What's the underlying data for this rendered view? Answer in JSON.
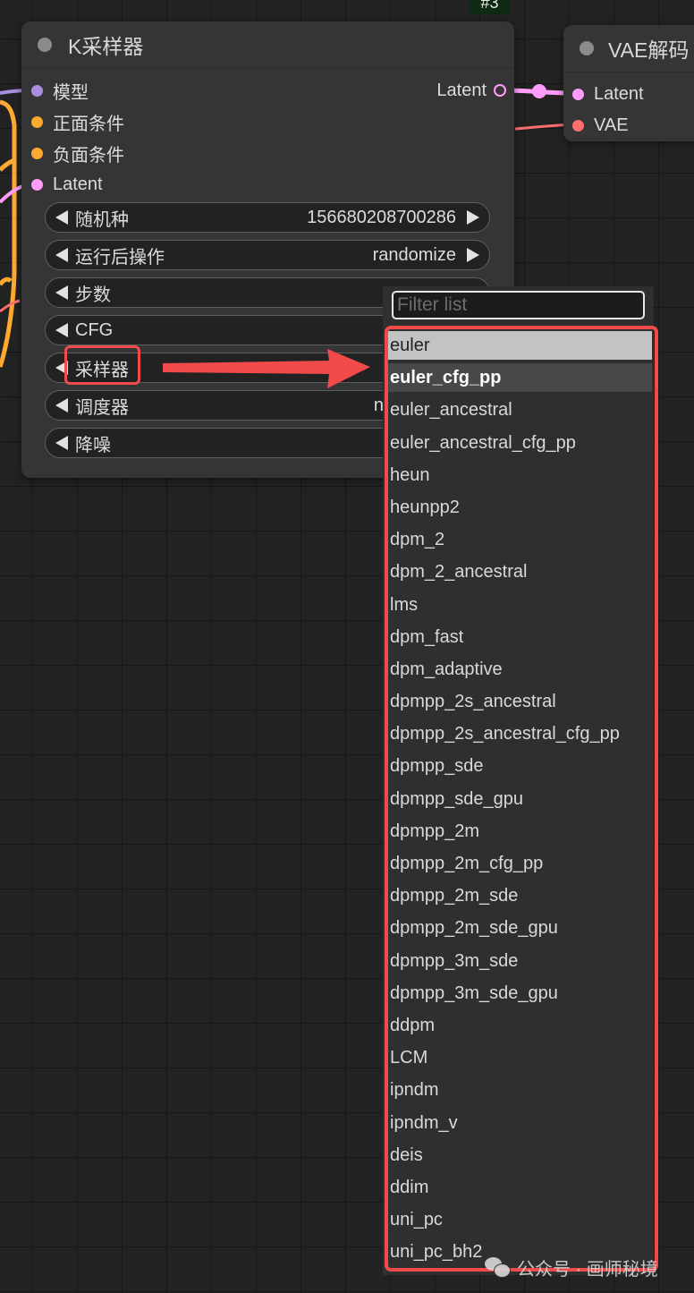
{
  "badge": "#3",
  "ksampler": {
    "title": "K采样器",
    "inputs": [
      {
        "label": "模型",
        "color": "#a98ee0"
      },
      {
        "label": "正面条件",
        "color": "#ffa931"
      },
      {
        "label": "负面条件",
        "color": "#ffa931"
      },
      {
        "label": "Latent",
        "color": "#ff9cf9"
      }
    ],
    "output": {
      "label": "Latent",
      "color": "#ff9cf9"
    },
    "widgets": [
      {
        "label": "随机种",
        "value": "156680208700286"
      },
      {
        "label": "运行后操作",
        "value": "randomize"
      },
      {
        "label": "步数",
        "value": ""
      },
      {
        "label": "CFG",
        "value": ""
      },
      {
        "label": "采样器",
        "value": ""
      },
      {
        "label": "调度器",
        "value": "n"
      },
      {
        "label": "降噪",
        "value": ""
      }
    ]
  },
  "vae_node": {
    "title": "VAE解码",
    "inputs": [
      {
        "label": "Latent",
        "color": "#ff9cf9"
      },
      {
        "label": "VAE",
        "color": "#ff6e6e"
      }
    ]
  },
  "sampler_menu": {
    "filter_placeholder": "Filter list",
    "filter_value": "",
    "selected": "euler",
    "hovered": "euler_cfg_pp",
    "items": [
      "euler",
      "euler_cfg_pp",
      "euler_ancestral",
      "euler_ancestral_cfg_pp",
      "heun",
      "heunpp2",
      "dpm_2",
      "dpm_2_ancestral",
      "lms",
      "dpm_fast",
      "dpm_adaptive",
      "dpmpp_2s_ancestral",
      "dpmpp_2s_ancestral_cfg_pp",
      "dpmpp_sde",
      "dpmpp_sde_gpu",
      "dpmpp_2m",
      "dpmpp_2m_cfg_pp",
      "dpmpp_2m_sde",
      "dpmpp_2m_sde_gpu",
      "dpmpp_3m_sde",
      "dpmpp_3m_sde_gpu",
      "ddpm",
      "LCM",
      "ipndm",
      "ipndm_v",
      "deis",
      "ddim",
      "uni_pc",
      "uni_pc_bh2"
    ]
  },
  "annotation_color": "#f04a4a",
  "watermark": "公众号 · 画师秘境"
}
